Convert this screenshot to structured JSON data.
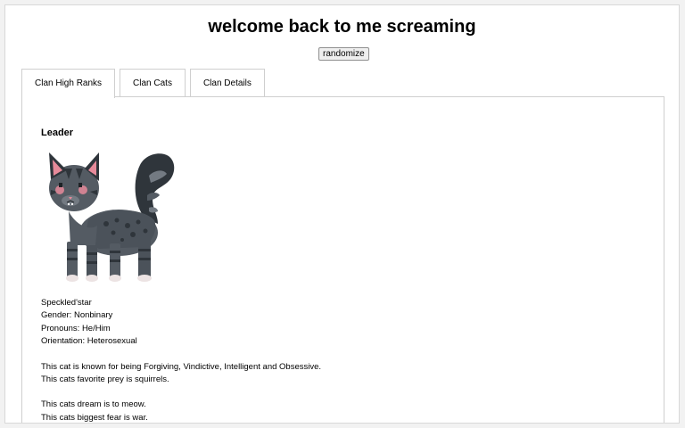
{
  "header": {
    "title": "welcome back to me screaming",
    "randomize_label": "randomize"
  },
  "tabs": [
    {
      "label": "Clan High Ranks",
      "active": true
    },
    {
      "label": "Clan Cats",
      "active": false
    },
    {
      "label": "Clan Details",
      "active": false
    }
  ],
  "leader": {
    "rank": "Leader",
    "name": "Speckled'star",
    "gender": "Gender: Nonbinary",
    "pronouns": "Pronouns: He/Him",
    "orientation": "Orientation: Heterosexual",
    "traits": "This cat is known for being Forgiving, Vindictive, Intelligent and Obsessive.",
    "prey": "This cats favorite prey is squirrels.",
    "dream": "This cats dream is to meow.",
    "fear": "This cats biggest fear is war."
  },
  "colors": {
    "fur_dark": "#2f353b",
    "fur_mid": "#545b63",
    "fur_light": "#737a82",
    "ear_inner": "#e68a9a",
    "paw": "#ece3e3"
  },
  "icons": {
    "cat": "cat-sprite"
  }
}
